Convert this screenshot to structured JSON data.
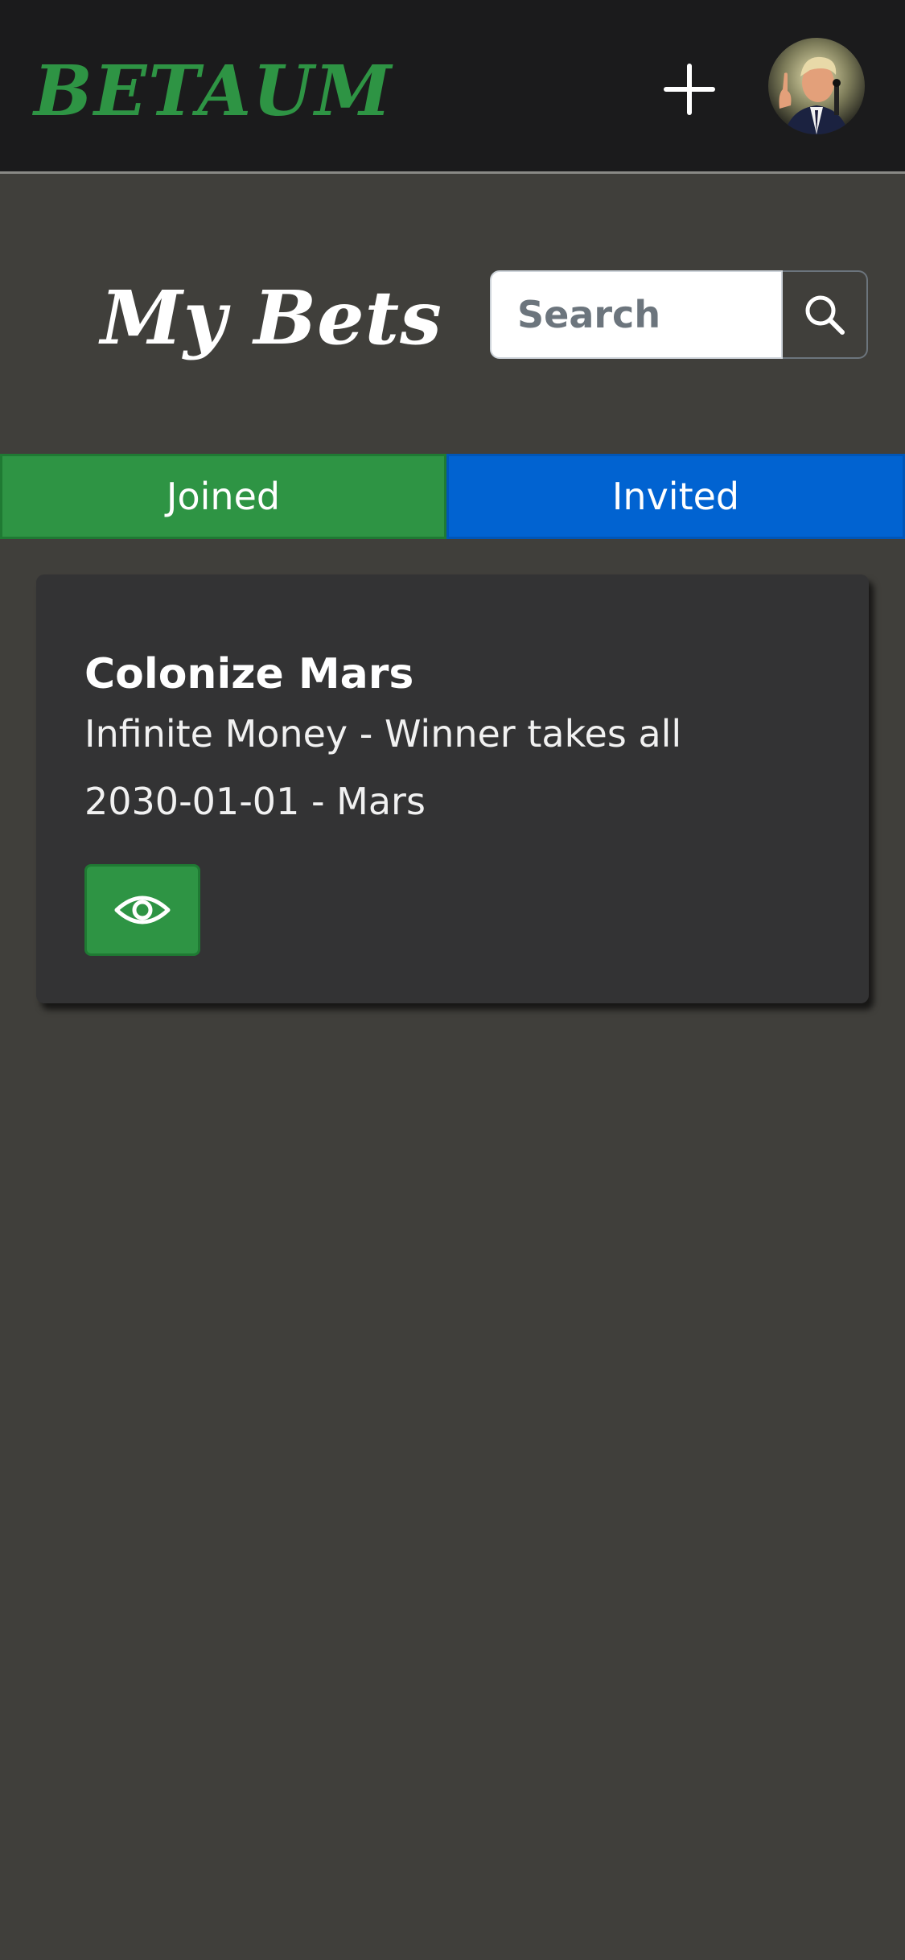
{
  "header": {
    "brand": "BETAUM",
    "add_icon": "plus-icon",
    "avatar_icon": "user-avatar"
  },
  "main": {
    "title": "My Bets",
    "search": {
      "placeholder": "Search",
      "value": "",
      "icon": "search-icon"
    },
    "tabs": [
      {
        "label": "Joined",
        "color": "#2e9444",
        "active": true
      },
      {
        "label": "Invited",
        "color": "#0163d1",
        "active": false
      }
    ],
    "bets": [
      {
        "title": "Colonize Mars",
        "subtitle": "Infinite Money - Winner takes all",
        "meta": "2030-01-01 - Mars",
        "action_icon": "eye-icon"
      }
    ]
  },
  "colors": {
    "accent_green": "#2e9444",
    "accent_blue": "#0163d1",
    "background": "#403f3b",
    "header_bg": "#1b1b1c",
    "card_bg": "#333334"
  }
}
